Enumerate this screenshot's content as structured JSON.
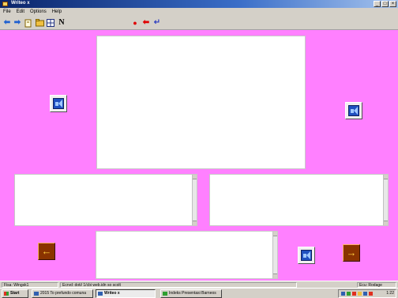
{
  "window": {
    "title": "Writeo x"
  },
  "menu": [
    "File",
    "Edit",
    "Options",
    "Help"
  ],
  "toolbar": {
    "icons": [
      "back-arrow",
      "forward-arrow",
      "new-file",
      "open-folder",
      "grid",
      "font",
      "record",
      "back-red",
      "enter-red"
    ],
    "font_label": "N"
  },
  "colors": {
    "stage": "#ff80ff",
    "titlebar": "#0a246a",
    "nav_button": "#8a3300"
  },
  "status": {
    "left": "Fisa: Wingsk1",
    "middle": "Ecrvd: doti/ 1/cbi web.idn so scolt",
    "right": "Ecu: Rodage"
  },
  "taskbar": {
    "start": "Start",
    "tasks": [
      "2015 To prefundo comuna",
      "Writeo x",
      "Indeks Presentasi Barneos"
    ],
    "clock": "1:22"
  }
}
